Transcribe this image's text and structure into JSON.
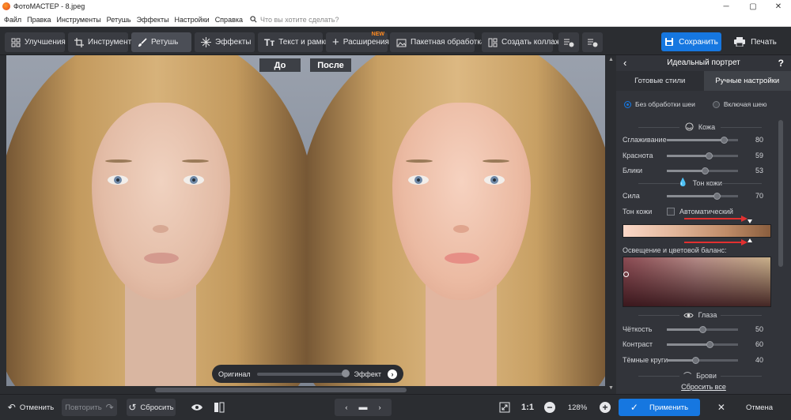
{
  "window": {
    "title": "ФотоМАСТЕР - 8.jpeg"
  },
  "menu": {
    "items": [
      "Файл",
      "Правка",
      "Инструменты",
      "Ретушь",
      "Эффекты",
      "Настройки",
      "Справка"
    ],
    "search_placeholder": "Что вы хотите сделать?"
  },
  "toolbar": {
    "items": [
      "Улучшения",
      "Инструменты",
      "Ретушь",
      "Эффекты",
      "Текст и рамки",
      "Расширения",
      "Пакетная обработка",
      "Создать коллаж"
    ],
    "new_badge": "NEW",
    "save_label": "Сохранить",
    "print_label": "Печать"
  },
  "canvas": {
    "before_label": "До",
    "after_label": "После",
    "compare_left": "Оригинал",
    "compare_right": "Эффект"
  },
  "panel": {
    "title": "Идеальный портрет",
    "tabs": [
      "Готовые стили",
      "Ручные настройки"
    ],
    "neck_options": [
      "Без обработки шеи",
      "Включая шею"
    ],
    "skin_header": "Кожа",
    "sliders_skin": [
      {
        "label": "Сглаживание",
        "value": "80",
        "level": 0.8
      },
      {
        "label": "Краснота",
        "value": "59",
        "level": 0.59
      },
      {
        "label": "Блики",
        "value": "53",
        "level": 0.53
      }
    ],
    "tone_header": "Тон кожи",
    "strength": {
      "label": "Сила",
      "value": "70",
      "level": 0.7
    },
    "tone_label": "Тон кожи",
    "auto_label": "Автоматический",
    "balance_label": "Освещение и цветовой баланс:",
    "eyes_header": "Глаза",
    "sliders_eyes": [
      {
        "label": "Чёткость",
        "value": "50",
        "level": 0.5
      },
      {
        "label": "Контраст",
        "value": "60",
        "level": 0.6
      },
      {
        "label": "Тёмные круги",
        "value": "40",
        "level": 0.4
      }
    ],
    "brows_header": "Брови",
    "reset_all": "Сбросить все"
  },
  "bottom": {
    "undo": "Отменить",
    "redo": "Повторить",
    "reset": "Сбросить",
    "ratio": "1:1",
    "zoom": "128%",
    "apply": "Применить",
    "cancel": "Отмена"
  },
  "colors": {
    "accent": "#1677e0",
    "badge": "#ff8a1f",
    "arrow": "#e23030"
  }
}
